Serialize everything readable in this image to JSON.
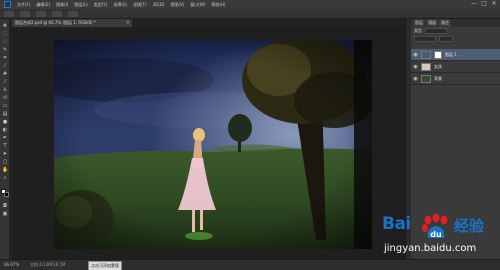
{
  "menubar": {
    "items": [
      "文件(F)",
      "编辑(E)",
      "图像(I)",
      "图层(L)",
      "类型(Y)",
      "选择(S)",
      "滤镜(T)",
      "3D(D)",
      "视图(V)",
      "窗口(W)",
      "帮助(H)"
    ],
    "controls": [
      "—",
      "□",
      "✕"
    ]
  },
  "document": {
    "tab_title": "图层合成2.psd @ 66.7% (图层 1, RGB/8) *",
    "tab_close": "×"
  },
  "status": {
    "zoom": "66.67%",
    "docinfo": "文档:4.12M/16.5M",
    "tooltip": "点击可添加蒙版"
  },
  "layers_panel": {
    "tabs": [
      "图层",
      "通道",
      "路径"
    ],
    "kind_label": "类型",
    "layers": [
      {
        "name": "图层 1",
        "visible": true,
        "selected": true
      },
      {
        "name": "女孩",
        "visible": true,
        "selected": false
      },
      {
        "name": "背景",
        "visible": true,
        "selected": false
      }
    ]
  },
  "watermark": {
    "logo": "Bai",
    "suffix": "经验",
    "url": "jingyan.baidu.com"
  },
  "colors": {
    "foreground": "#ffffff",
    "background": "#000000",
    "accent": "#1a73c8"
  }
}
